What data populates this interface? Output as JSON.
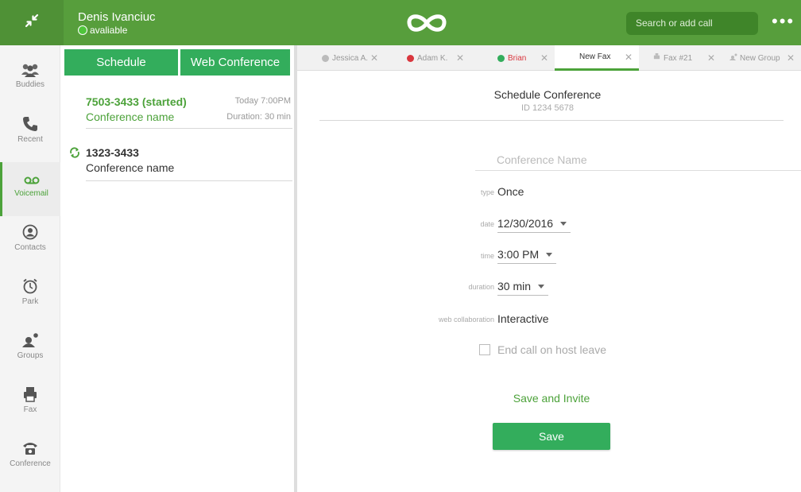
{
  "colors": {
    "topbar": "#579e3c",
    "accent": "#33ad5c",
    "active_nav": "#4ca23a",
    "busy": "#d9363e",
    "online": "#4fc53b"
  },
  "user": {
    "name": "Denis Ivanciuc",
    "status": "avaliable"
  },
  "search": {
    "placeholder": "Search or add call"
  },
  "nav": {
    "items": [
      {
        "label": "Buddies",
        "icon": "buddies-icon"
      },
      {
        "label": "Recent",
        "icon": "phone-icon"
      },
      {
        "label": "Voicemail",
        "icon": "voicemail-icon",
        "active": true
      },
      {
        "label": "Contacts",
        "icon": "contact-icon"
      },
      {
        "label": "Park",
        "icon": "park-icon"
      },
      {
        "label": "Groups",
        "icon": "groups-icon"
      },
      {
        "label": "Fax",
        "icon": "fax-icon"
      },
      {
        "label": "Conference",
        "icon": "conference-icon"
      }
    ]
  },
  "segments": {
    "schedule": "Schedule",
    "web_conference": "Web Conference"
  },
  "conferences": [
    {
      "number": "7503-3433 (started)",
      "name": "Conference name",
      "time": "Today 7:00PM",
      "duration": "Duration: 30 min"
    },
    {
      "number": "1323-3433",
      "name": "Conference name",
      "icon": "refresh-icon"
    }
  ],
  "tabs": [
    {
      "label": "Jessica A.",
      "status": "offline"
    },
    {
      "label": "Adam K.",
      "status": "busy"
    },
    {
      "label": "Brian",
      "status": "online"
    },
    {
      "label": "New Fax",
      "active": true
    },
    {
      "label": "Fax #21",
      "icon": "fax-icon"
    },
    {
      "label": "New Group",
      "icon": "group-icon"
    }
  ],
  "form": {
    "title": "Schedule Conference",
    "id": "ID 1234 5678",
    "name_placeholder": "Conference Name",
    "type_label": "type",
    "type_value": "Once",
    "date_label": "date",
    "date_value": "12/30/2016",
    "time_label": "time",
    "time_value": "3:00 PM",
    "duration_label": "duration",
    "duration_value": "30 min",
    "collab_label": "web collaboration",
    "collab_value": "Interactive",
    "end_call_label": "End call on host leave",
    "save_invite": "Save and Invite",
    "save": "Save"
  }
}
